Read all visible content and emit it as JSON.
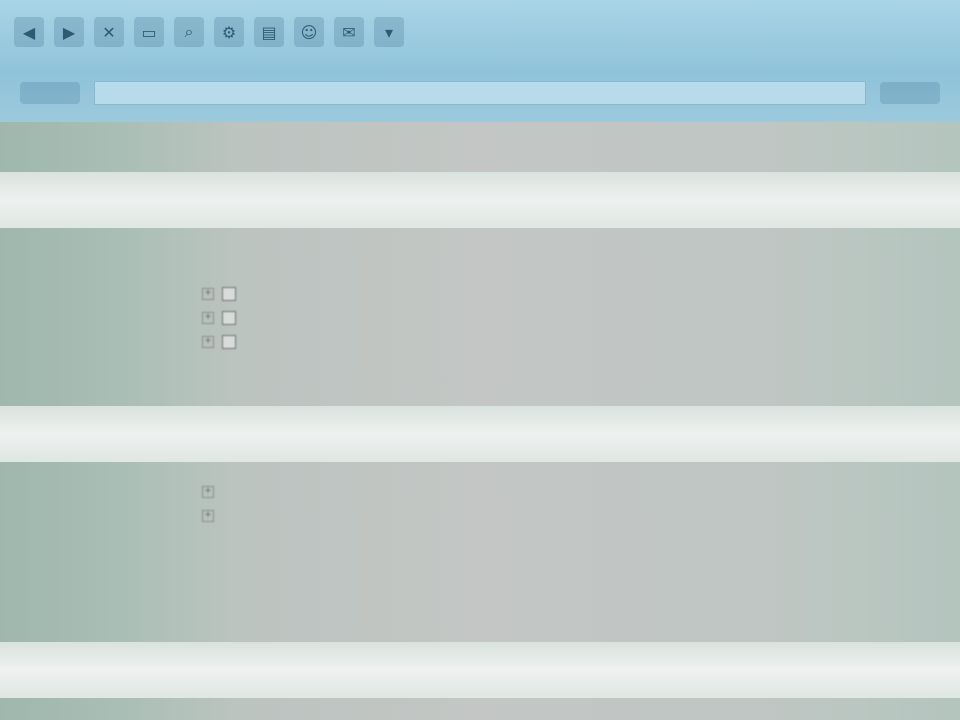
{
  "toolbar": {
    "row1_icons": [
      "back-icon",
      "forward-icon",
      "close-icon",
      "folder-icon",
      "search-icon",
      "settings-icon",
      "print-icon",
      "user-icon",
      "mail-icon",
      "arrow-down-icon"
    ],
    "row1_glyphs": [
      "◀",
      "▶",
      "✕",
      "▭",
      "⌕",
      "⚙",
      "▤",
      "☺",
      "✉",
      "▾"
    ]
  },
  "main": {
    "tree": [
      {
        "indent": 1,
        "expander": "",
        "checkbox": false
      },
      {
        "indent": 1,
        "expander": "",
        "checkbox": false
      },
      {
        "indent": 1,
        "expander": "+",
        "checkbox": true
      },
      {
        "indent": 1,
        "expander": "+",
        "checkbox": true
      },
      {
        "indent": 1,
        "expander": "+",
        "checkbox": true
      },
      {
        "indent": 0,
        "expander": "",
        "checkbox": false
      },
      {
        "indent": 1,
        "expander": "",
        "checkbox": false
      }
    ],
    "tree2": [
      {
        "indent": 1,
        "expander": "+",
        "checkbox": false
      },
      {
        "indent": 1,
        "expander": "+",
        "checkbox": false
      },
      {
        "indent": 1,
        "expander": "",
        "checkbox": false
      },
      {
        "indent": 1,
        "expander": "",
        "checkbox": false
      },
      {
        "indent": 1,
        "expander": "",
        "checkbox": false
      },
      {
        "indent": 1,
        "expander": "",
        "checkbox": false
      },
      {
        "indent": 1,
        "expander": "",
        "checkbox": false
      }
    ]
  },
  "colors": {
    "toolbar_bg": "#8fc3da",
    "pane_bg": "#c3c6c4",
    "band_bg": "#eef1ef",
    "text": "#4f5552"
  }
}
